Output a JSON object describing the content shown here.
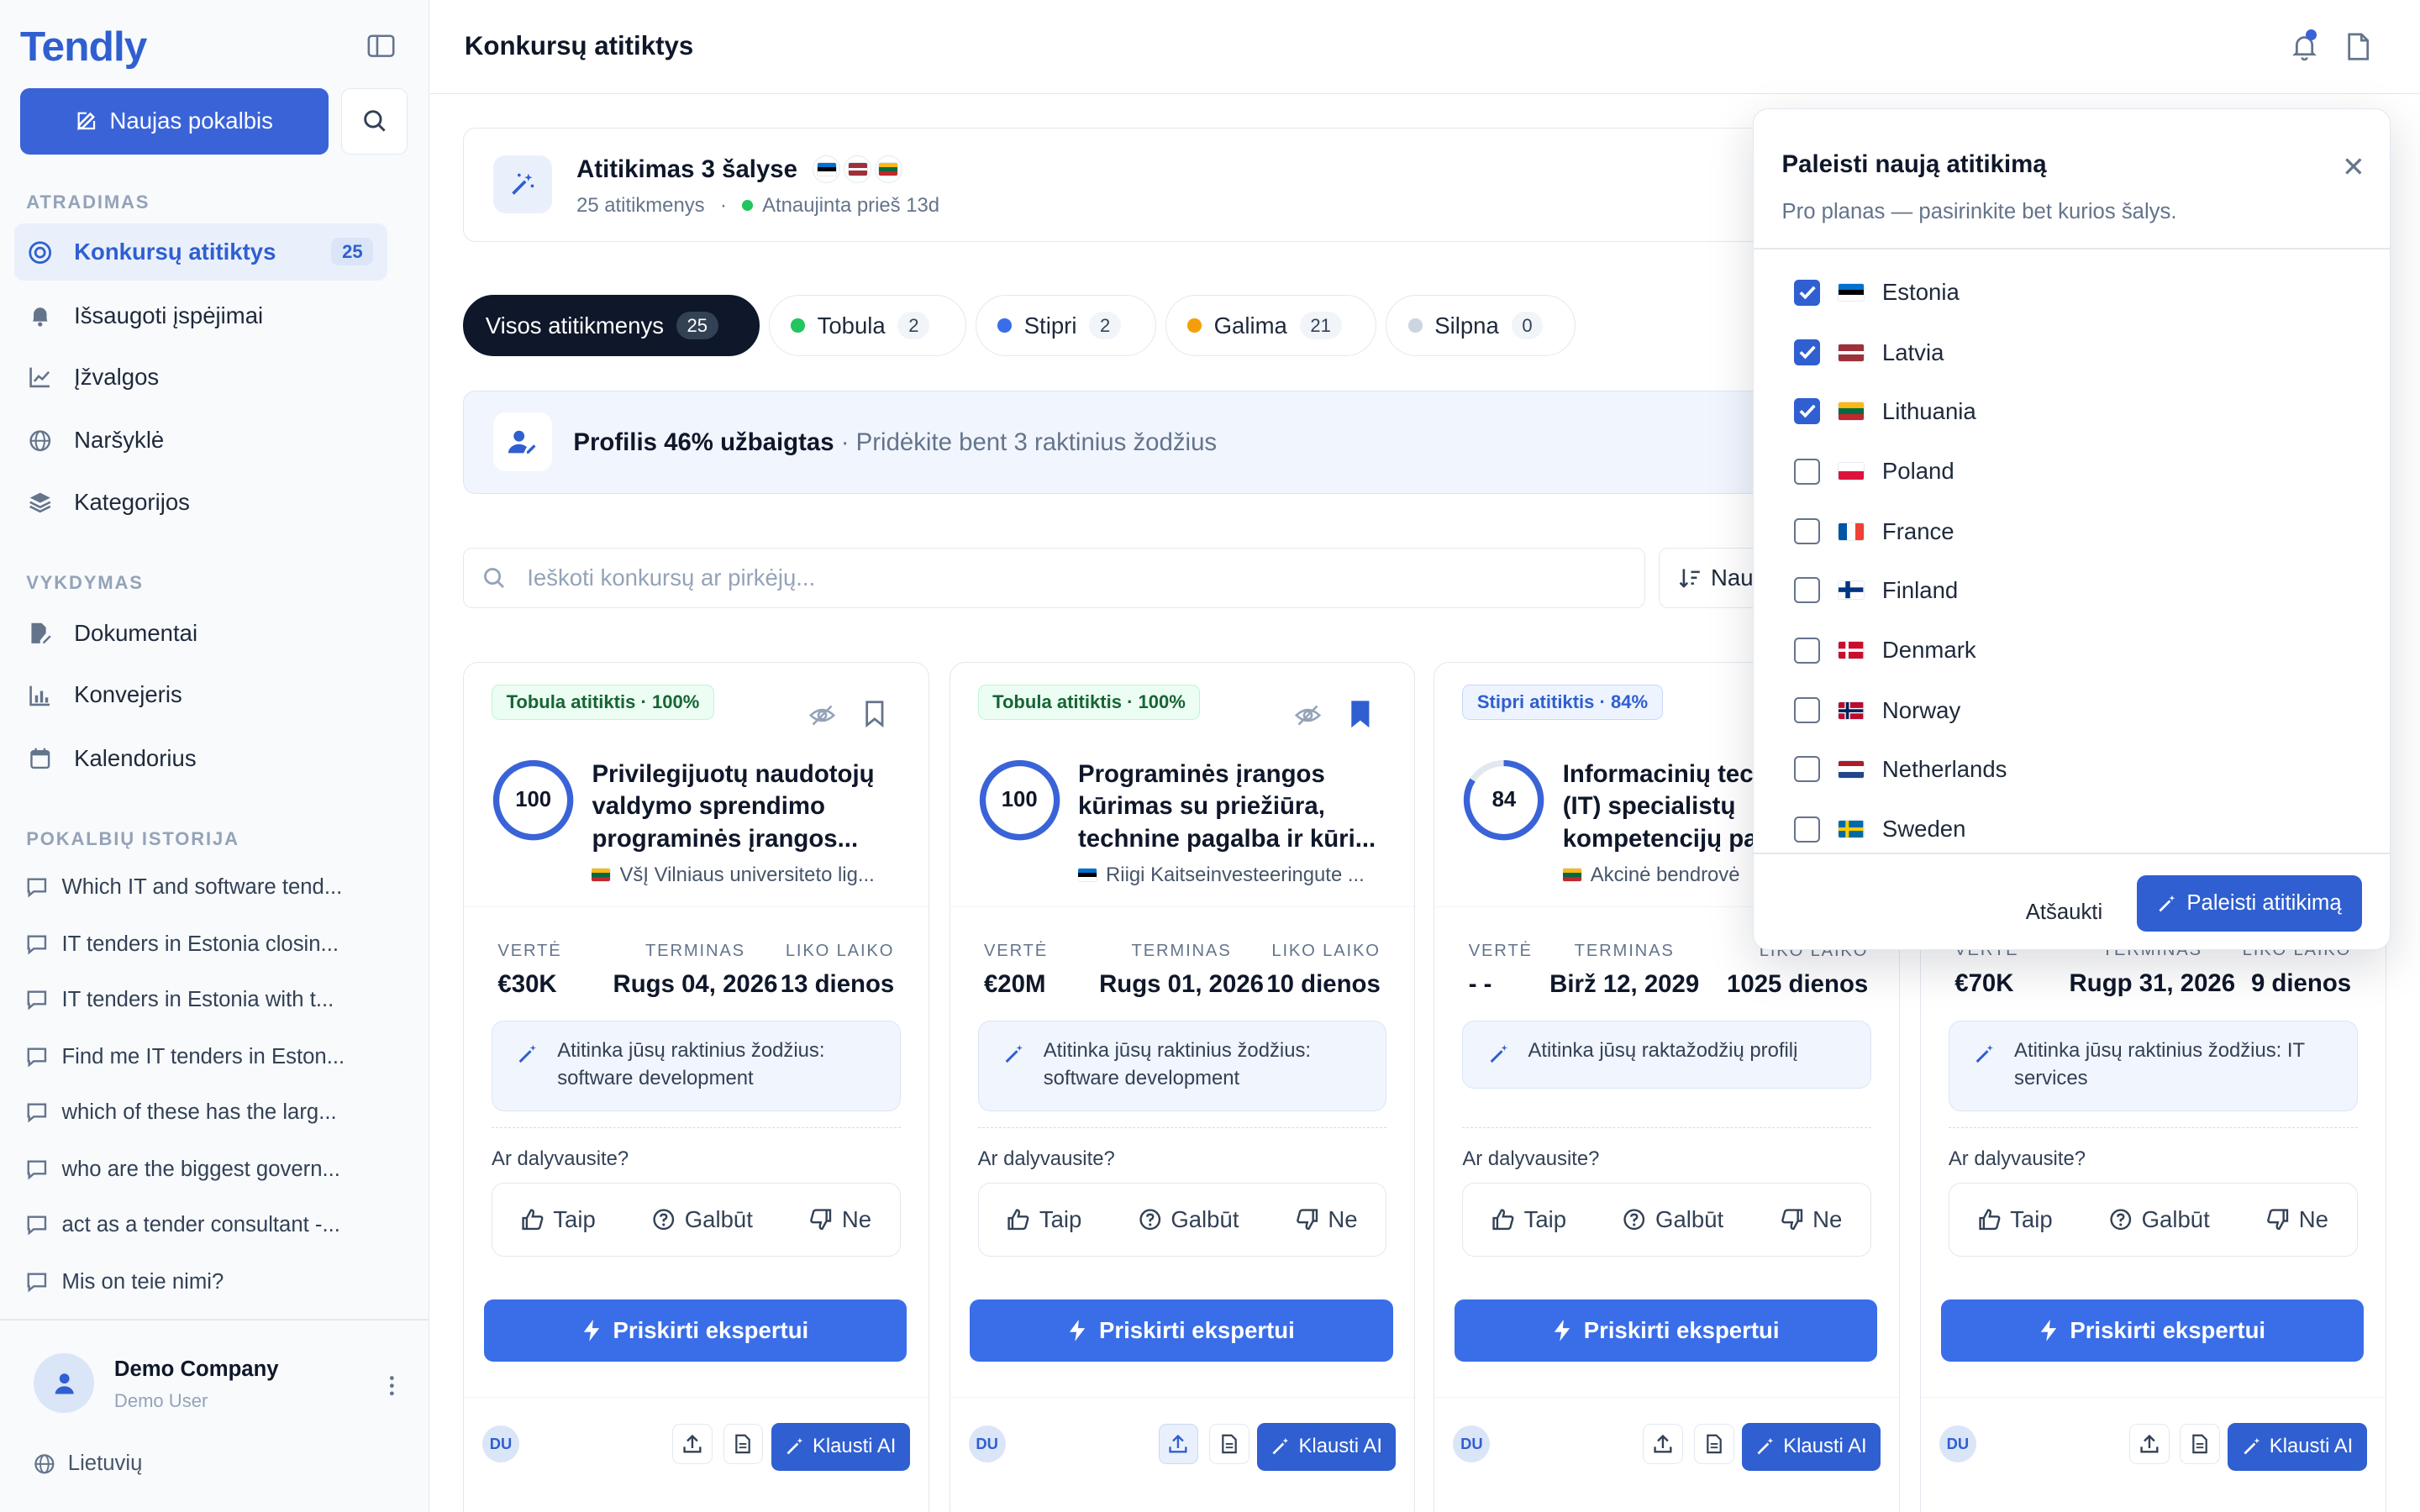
{
  "app": {
    "logo": "Tendly",
    "page_title": "Konkursų atitiktys"
  },
  "sidebar": {
    "new_chat": "Naujas pokalbis",
    "sections": {
      "discovery": "ATRADIMAS",
      "execution": "VYKDYMAS",
      "history": "POKALBIŲ ISTORIJA"
    },
    "discovery_items": [
      {
        "label": "Konkursų atitiktys",
        "badge": "25",
        "icon": "target-icon"
      },
      {
        "label": "Išsaugoti įspėjimai",
        "icon": "bell-icon"
      },
      {
        "label": "Įžvalgos",
        "icon": "chart-line-icon"
      },
      {
        "label": "Naršyklė",
        "icon": "globe-icon"
      },
      {
        "label": "Kategorijos",
        "icon": "layers-icon"
      }
    ],
    "execution_items": [
      {
        "label": "Dokumentai",
        "icon": "document-edit-icon"
      },
      {
        "label": "Konvejeris",
        "icon": "bar-chart-icon"
      },
      {
        "label": "Kalendorius",
        "icon": "calendar-icon"
      }
    ],
    "history": [
      "Which IT and software tend...",
      "IT tenders in Estonia closin...",
      "IT tenders in Estonia with t...",
      "Find me IT tenders in Eston...",
      "which of these has the larg...",
      "who are the biggest govern...",
      "act as a tender consultant -...",
      "Mis on teie nimi?"
    ],
    "user": {
      "name": "Demo Company",
      "sub": "Demo User"
    },
    "language": "Lietuvių"
  },
  "match_summary": {
    "title": "Atitikimas 3 šalyse",
    "count": "25 atitikmenys",
    "dot": "·",
    "updated": "Atnaujinta prieš 13d"
  },
  "filters": [
    {
      "label": "Visos atitikmenys",
      "count": "25"
    },
    {
      "label": "Tobula",
      "count": "2",
      "color": "#22c55e"
    },
    {
      "label": "Stipri",
      "count": "2",
      "color": "#3a6ee8"
    },
    {
      "label": "Galima",
      "count": "21",
      "color": "#f59e0b"
    },
    {
      "label": "Silpna",
      "count": "0",
      "color": "#cbd5e1"
    }
  ],
  "profile_banner": {
    "bold": "Profilis 46% užbaigtas",
    "rest": " · Pridėkite bent 3 raktinius žodžius"
  },
  "search": {
    "placeholder": "Ieškoti konkursų ar pirkėjų...",
    "sort_label": "Nau"
  },
  "card_common": {
    "labels": {
      "value": "VERTĖ",
      "deadline": "TERMINAS",
      "remaining": "LIKO LAIKO"
    },
    "question": "Ar dalyvausite?",
    "yes": "Taip",
    "maybe": "Galbūt",
    "no": "Ne",
    "assign": "Priskirti ekspertui",
    "ask": "Klausti AI",
    "initials": "DU"
  },
  "cards": [
    {
      "tag": "Tobula atitiktis · 100%",
      "score": "100",
      "score_pct": 100,
      "title": "Privilegijuotų naudotojų valdymo sprendimo programinės įrangos...",
      "buyer": "VšĮ Vilniaus universiteto lig...",
      "value": "€30K",
      "deadline": "Rugs 04, 2026",
      "remaining": "13 dienos",
      "keywords": "Atitinka jūsų raktinius žodžius: software development"
    },
    {
      "tag": "Tobula atitiktis · 100%",
      "score": "100",
      "score_pct": 100,
      "title": "Programinės įrangos kūrimas su priežiūra, technine pagalba ir kūri...",
      "buyer": "Riigi Kaitseinvesteeringute ...",
      "value": "€20M",
      "deadline": "Rugs 01, 2026",
      "remaining": "10 dienos",
      "keywords": "Atitinka jūsų raktinius žodžius: software development"
    },
    {
      "tag": "Stipri atitiktis · 84%",
      "score": "84",
      "score_pct": 84,
      "title": "Informacinių technologijų (IT) specialistų kompetencijų paslaugos",
      "buyer": "Akcinė bendrovė",
      "value": "- -",
      "deadline": "Birž 12, 2029",
      "remaining": "1025 dienos",
      "keywords": "Atitinka jūsų raktažodžių profilį"
    },
    {
      "value": "€70K",
      "deadline": "Rugp 31, 2026",
      "remaining": "9 dienos",
      "keywords": "Atitinka jūsų raktinius žodžius: IT services"
    }
  ],
  "popover": {
    "title": "Paleisti naują atitikimą",
    "subtitle": "Pro planas — pasirinkite bet kurios šalys.",
    "countries": [
      {
        "name": "Estonia",
        "checked": true
      },
      {
        "name": "Latvia",
        "checked": true
      },
      {
        "name": "Lithuania",
        "checked": true
      },
      {
        "name": "Poland",
        "checked": false
      },
      {
        "name": "France",
        "checked": false
      },
      {
        "name": "Finland",
        "checked": false
      },
      {
        "name": "Denmark",
        "checked": false
      },
      {
        "name": "Norway",
        "checked": false
      },
      {
        "name": "Netherlands",
        "checked": false
      },
      {
        "name": "Sweden",
        "checked": false
      }
    ],
    "cancel": "Atšaukti",
    "run": "Paleisti atitikimą"
  }
}
